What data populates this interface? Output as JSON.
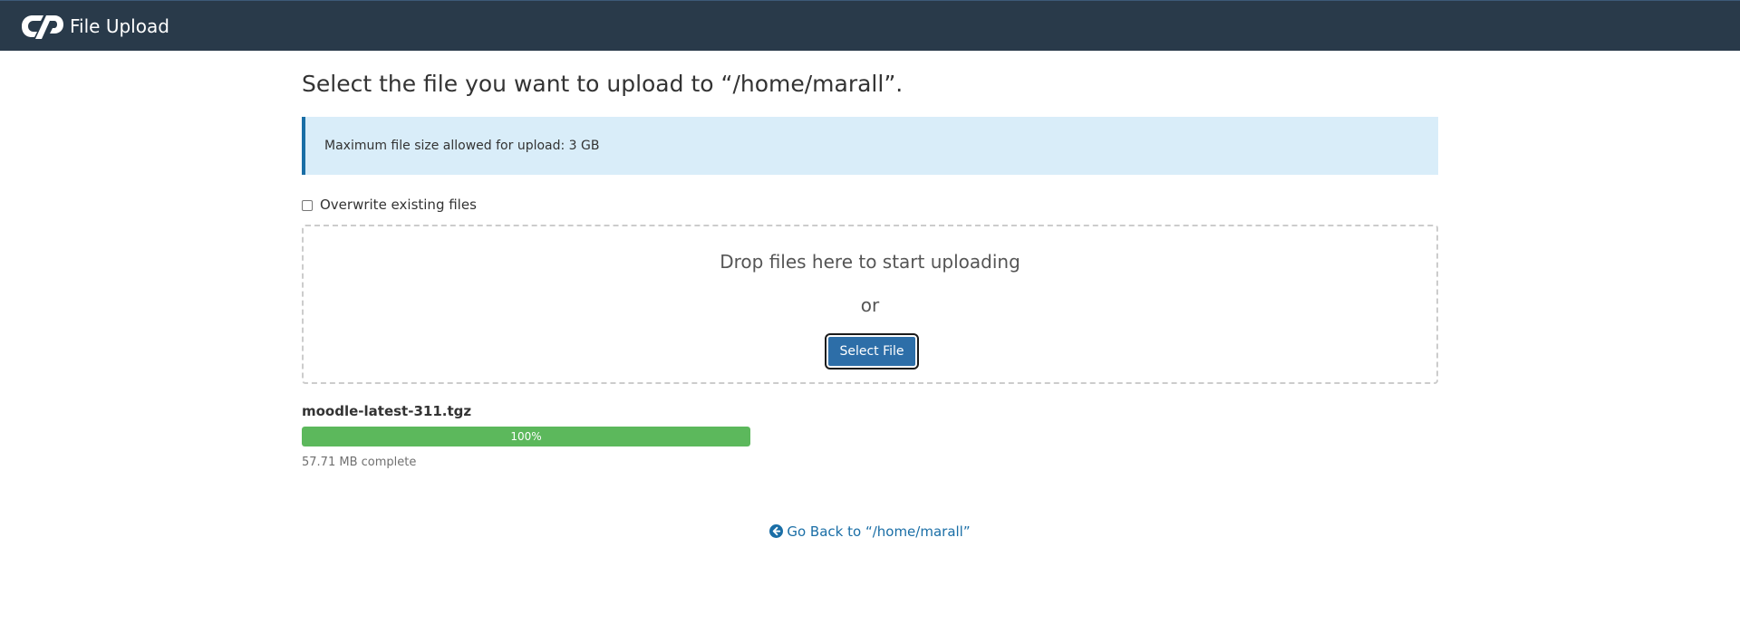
{
  "header": {
    "app_title": "File Upload",
    "logo_icon": "cpanel-logo-icon"
  },
  "colors": {
    "header_bg": "#293a4a",
    "alert_bg": "#d9edf9",
    "alert_border": "#1a6ea6",
    "primary_button": "#2d6ea8",
    "progress_fill": "#5cb85c",
    "link": "#1a6ea6"
  },
  "main": {
    "title": "Select the file you want to upload to “/home/marall”.",
    "max_size_notice": "Maximum file size allowed for upload: 3 GB",
    "overwrite_label": "Overwrite existing files",
    "overwrite_checked": false,
    "dropzone": {
      "drop_text": "Drop files here to start uploading",
      "or_text": "or",
      "select_button_label": "Select File"
    },
    "uploads": [
      {
        "file_name": "moodle-latest-311.tgz",
        "progress_percent": 100,
        "progress_label": "100%",
        "status_text": "57.71 MB complete"
      }
    ],
    "go_back": {
      "label": "Go Back to “/home/marall”",
      "icon": "arrow-circle-left-icon"
    }
  }
}
